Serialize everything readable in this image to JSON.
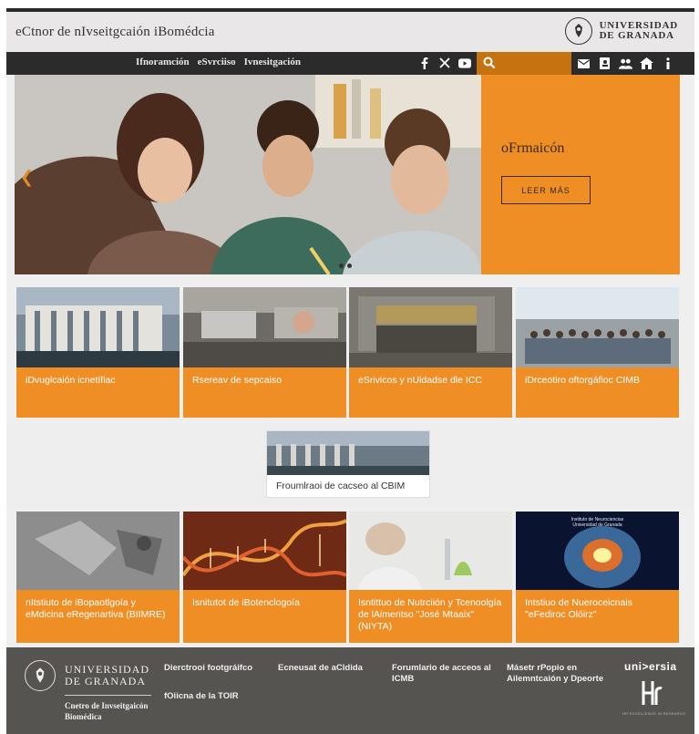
{
  "header": {
    "site_title": "eCtnor de nIvseitgcaión iBomédcia",
    "university": [
      "UNIVERSIDAD",
      "DE GRANADA"
    ]
  },
  "nav": {
    "links": [
      "Ifnoramción",
      "eSvrciiso",
      "Ivnesitgación"
    ],
    "social_icons": [
      "facebook-icon",
      "x-icon",
      "youtube-icon"
    ],
    "search_icon": "search-icon",
    "utility_icons": [
      "mail-icon",
      "directory-icon",
      "users-icon",
      "home-icon",
      "info-icon"
    ]
  },
  "hero": {
    "title": "oFrmaicón",
    "button": "LEER MÁS",
    "prev_icon": "chevron-left-icon",
    "slide_count": 2
  },
  "cards_row1": [
    {
      "label": "iDvuglcaión icnetífiac"
    },
    {
      "label": "Rsereav de sepcaiso"
    },
    {
      "label": "eSrivicos y nUidadse dle ICC"
    },
    {
      "label": "iDrceotiro oftorgáfioc CIMB"
    }
  ],
  "form_card": {
    "label": "Froumlraoi de cacseo al CBIM"
  },
  "cards_row2": [
    {
      "label": "nItstiuto de iBopaotlgoía y eMdicina eRegenartiva (BIIMRE)"
    },
    {
      "label": "Isnitutot de iBotenclogoía"
    },
    {
      "label": "Isntittuo de Nutrciión y Tcenoolgía de lAimentso \"José Mtaaix\" (NIYTA)"
    },
    {
      "label": "Intstiuo de Nueroceicnais \"eFediroc Olóirz\""
    }
  ],
  "card4_row2_overlay": [
    "Instituto de Neurociencias",
    "Universidad de Granada"
  ],
  "footer": {
    "university": [
      "UNIVERSIDAD",
      "DE GRANADA"
    ],
    "subtitle": [
      "Cnetro de Invseitgaicón",
      "Biomédica"
    ],
    "links": [
      "Dierctrooi footgráifco",
      "Ecneusat de aCldida",
      "Forumlario de acceos al ICMB",
      "Másetr rPopio en Ailemntcaión y Dpeorte",
      "fOiicna de la TOIR"
    ],
    "universia": "uni>ersia",
    "hr_badge": "HR",
    "hr_caption": "HR EXCELLENCE IN RESEARCH"
  },
  "colors": {
    "accent_orange": "#ee8e25",
    "nav_dark": "#2b2b2b",
    "footer_gray": "#565451",
    "header_bg": "#e9e7e7"
  }
}
